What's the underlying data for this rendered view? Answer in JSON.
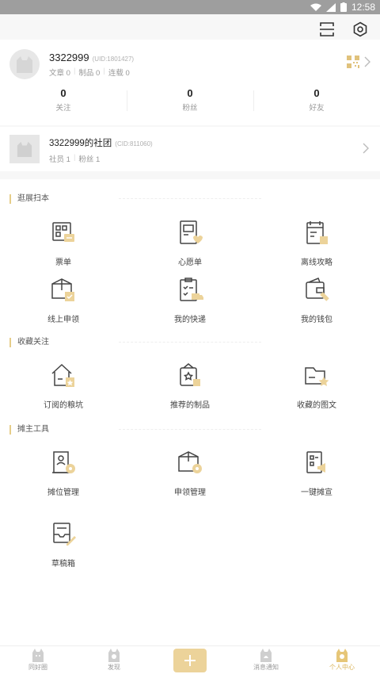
{
  "status_bar": {
    "time": "12:58"
  },
  "top_actions": {
    "scan_icon": "scan-icon",
    "settings_icon": "settings-icon"
  },
  "profile": {
    "name": "3322999",
    "uid": "(UID:1801427)",
    "stats": {
      "articles": "文章 0",
      "products": "制品 0",
      "serials": "连载 0"
    },
    "follow": [
      {
        "num": "0",
        "label": "关注"
      },
      {
        "num": "0",
        "label": "粉丝"
      },
      {
        "num": "0",
        "label": "好友"
      }
    ]
  },
  "club": {
    "name": "3322999的社团",
    "cid": "(CID:811060)",
    "members": "社员 1",
    "fans": "粉丝 1"
  },
  "sections": {
    "expo": {
      "title": "逛展扫本",
      "items": [
        {
          "label": "票单",
          "icon": "ticket-icon"
        },
        {
          "label": "心愿单",
          "icon": "wishlist-icon"
        },
        {
          "label": "离线攻略",
          "icon": "offline-guide-icon"
        },
        {
          "label": "线上申领",
          "icon": "online-claim-icon"
        },
        {
          "label": "我的快递",
          "icon": "delivery-icon"
        },
        {
          "label": "我的钱包",
          "icon": "wallet-icon"
        }
      ]
    },
    "favorites": {
      "title": "收藏关注",
      "items": [
        {
          "label": "订阅的粮坑",
          "icon": "subscribed-icon"
        },
        {
          "label": "推荐的制品",
          "icon": "recommended-icon"
        },
        {
          "label": "收藏的图文",
          "icon": "favorite-posts-icon"
        }
      ]
    },
    "tools": {
      "title": "摊主工具",
      "items": [
        {
          "label": "摊位管理",
          "icon": "booth-management-icon"
        },
        {
          "label": "申领管理",
          "icon": "claim-management-icon"
        },
        {
          "label": "一键摊宣",
          "icon": "promote-icon"
        },
        {
          "label": "草稿箱",
          "icon": "drafts-icon"
        }
      ]
    }
  },
  "tabbar": [
    {
      "label": "同好圈",
      "active": false
    },
    {
      "label": "发现",
      "active": false
    },
    {
      "label": "",
      "active": false
    },
    {
      "label": "消息通知",
      "active": false
    },
    {
      "label": "个人中心",
      "active": true
    }
  ],
  "colors": {
    "accent": "#e6cd8a",
    "accent_dark": "#d9b45a",
    "icon_stroke": "#444444"
  }
}
